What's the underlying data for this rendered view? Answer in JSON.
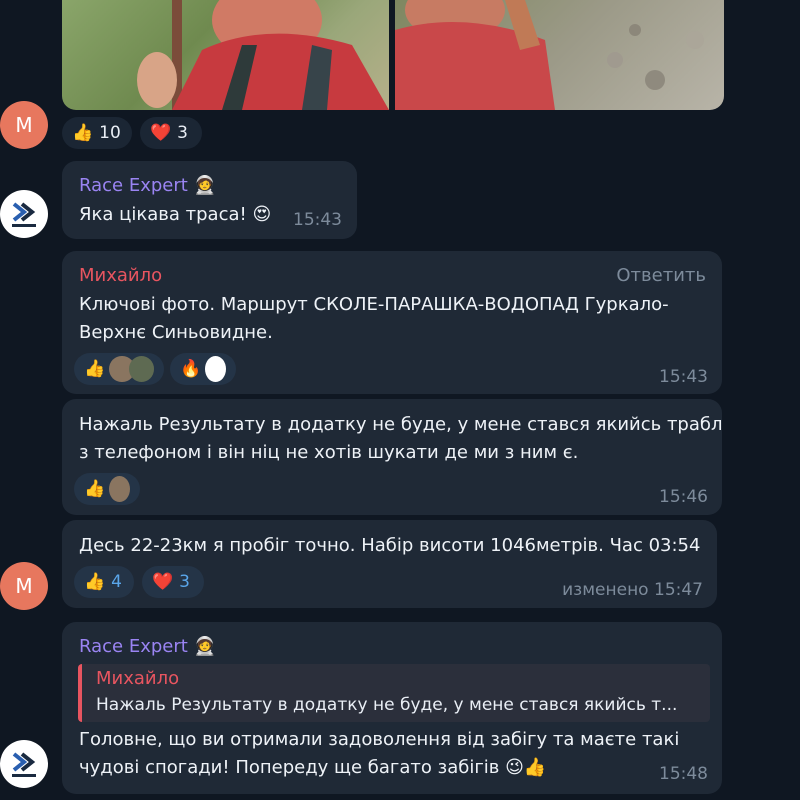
{
  "album_message": {
    "avatar_letter": "M",
    "reactions": [
      {
        "emoji": "👍",
        "count": "10"
      },
      {
        "emoji": "❤️",
        "count": "3"
      }
    ]
  },
  "msg_expert_1": {
    "sender": "Race Expert",
    "sender_emoji": "🧑‍🚀",
    "text": "Яка цікава траса! 😍",
    "time": "15:43"
  },
  "msg_mykh_1": {
    "sender": "Михайло",
    "reply_label": "Ответить",
    "lines": [
      "Ключові фото. Маршрут СКОЛЕ-ПАРАШКА-ВОДОПАД Гуркало-",
      "Верхнє Синьовидне."
    ],
    "reactions": [
      {
        "emoji": "👍"
      },
      {
        "emoji": "🔥"
      }
    ],
    "time": "15:43"
  },
  "msg_mykh_2": {
    "lines": [
      "Нажаль Результату в додатку не буде, у мене стався якийсь трабл",
      "з телефоном і він ніц не хотів шукати де ми з ним є."
    ],
    "reactions": [
      {
        "emoji": "👍"
      }
    ],
    "time": "15:46"
  },
  "msg_mykh_3": {
    "avatar_letter": "M",
    "text": "Десь 22-23км я пробіг точно. Набір висоти 1046метрів. Час 03:54",
    "reactions": [
      {
        "emoji": "👍",
        "count": "4"
      },
      {
        "emoji": "❤️",
        "count": "3"
      }
    ],
    "edited": "изменено",
    "time": "15:47"
  },
  "msg_expert_2": {
    "sender": "Race Expert",
    "sender_emoji": "🧑‍🚀",
    "quote_name": "Михайло",
    "quote_text": "Нажаль Результату в додатку не буде, у мене стався якийсь т...",
    "lines": [
      "Головне, що ви отримали задоволення від забігу та маєте такі",
      "чудові спогади!  Попереду ще багато забігів 😉👍"
    ],
    "time": "15:48"
  }
}
